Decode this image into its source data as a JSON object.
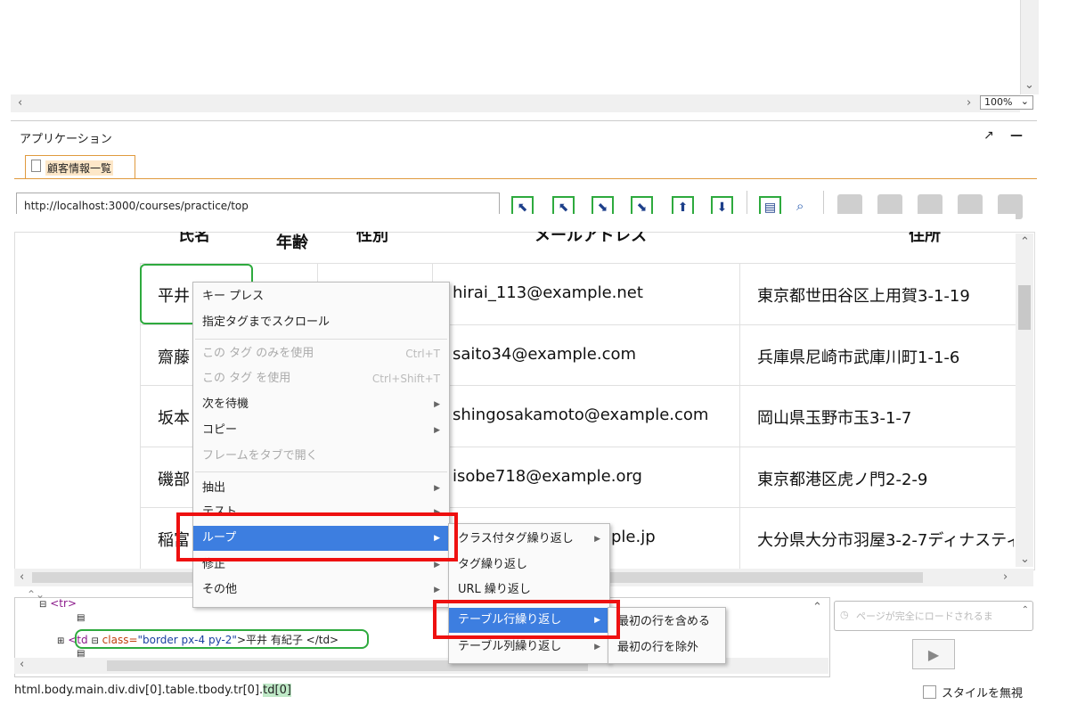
{
  "preview": {
    "zoom": "100%"
  },
  "app": {
    "title": "アプリケーション",
    "tab_label": "顧客情報一覧"
  },
  "toolbar": {
    "url": "http://localhost:3000/courses/practice/top"
  },
  "table": {
    "headers": [
      "氏名",
      "年齢",
      "性別",
      "メールアドレス",
      "住所"
    ],
    "rows": [
      {
        "name": "平井",
        "email": "hirai_113@example.net",
        "address": "東京都世田谷区上用賀3-1-19"
      },
      {
        "name": "齋藤",
        "email": "saito34@example.com",
        "address": "兵庫県尼崎市武庫川町1-1-6"
      },
      {
        "name": "坂本",
        "email": "shingosakamoto@example.com",
        "address": "岡山県玉野市玉3-1-7"
      },
      {
        "name": "磯部",
        "email": "isobe718@example.org",
        "address": "東京都港区虎ノ門2-2-9"
      },
      {
        "name": "稲富",
        "email": "ple.jp",
        "address": "大分県大分市羽屋3-2-7ディナスティ"
      }
    ]
  },
  "context_menu": {
    "items": [
      {
        "label": "キー プレス"
      },
      {
        "label": "指定タグまでスクロール"
      },
      {
        "label": "この タグ のみを使用",
        "shortcut": "Ctrl+T",
        "disabled": true
      },
      {
        "label": "この タグ を使用",
        "shortcut": "Ctrl+Shift+T",
        "disabled": true
      },
      {
        "label": "次を待機",
        "submenu": true
      },
      {
        "label": "コピー",
        "submenu": true
      },
      {
        "label": "フレームをタブで開く",
        "disabled": true
      },
      {
        "label": "抽出",
        "submenu": true
      },
      {
        "label": "テスト",
        "submenu": true
      },
      {
        "label": "ループ",
        "submenu": true,
        "highlighted": true
      },
      {
        "label": "修正",
        "submenu": true
      },
      {
        "label": "その他",
        "submenu": true
      }
    ]
  },
  "loop_submenu": {
    "items": [
      {
        "label": "クラス付タグ繰り返し",
        "submenu": true
      },
      {
        "label": "タグ繰り返し"
      },
      {
        "label": "URL 繰り返し"
      },
      {
        "label": "テーブル行繰り返し",
        "submenu": true,
        "highlighted": true
      },
      {
        "label": "テーブル列繰り返し",
        "submenu": true
      }
    ]
  },
  "row_submenu": {
    "items": [
      {
        "label": "最初の行を含める"
      },
      {
        "label": "最初の行を除外"
      }
    ]
  },
  "dom_tree": {
    "tr_tag": "<tr>",
    "td_open": "<td",
    "td_attr": "class=",
    "td_value": "\"border px-4 py-2\"",
    "td_text": ">平井 有紀子 </td>"
  },
  "wait_placeholder": "ページが完全にロードされるま",
  "status": {
    "path_prefix": "html.body.main.div.div[0].table.tbody.tr[0].",
    "path_highlight": "td[0]",
    "ignore_style": "スタイルを無視"
  }
}
